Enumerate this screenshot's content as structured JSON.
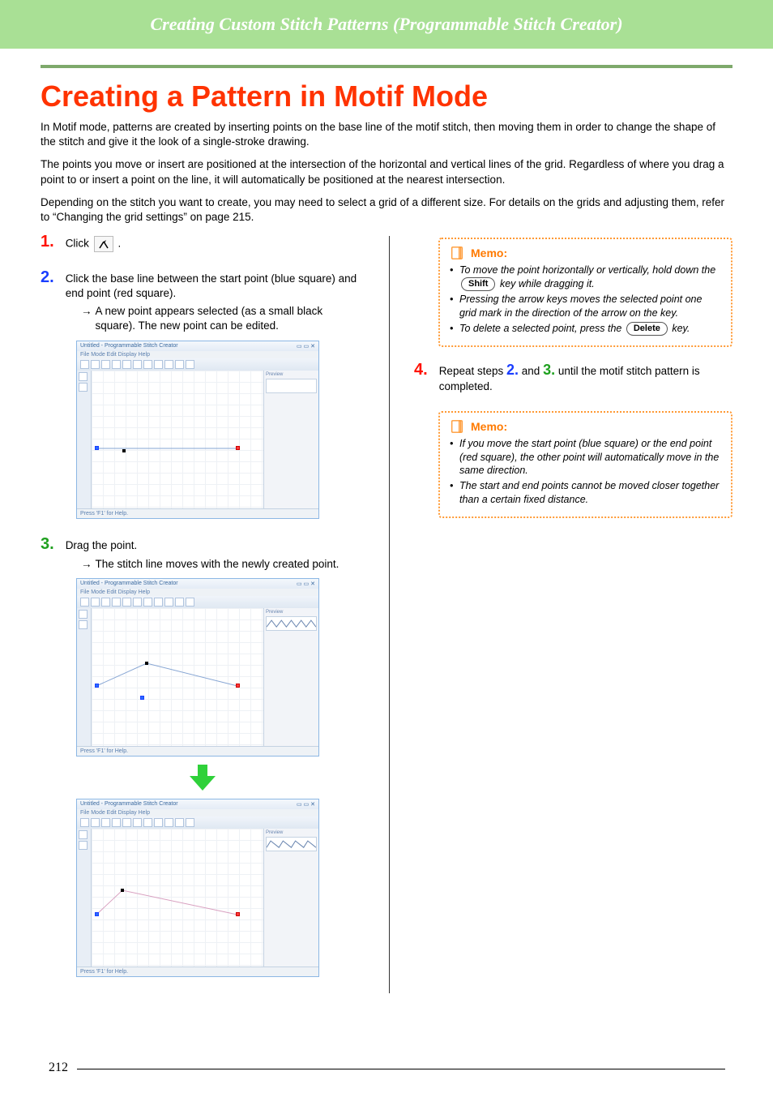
{
  "header": {
    "chapter_title": "Creating Custom Stitch Patterns (Programmable Stitch Creator)"
  },
  "title": "Creating a Pattern in Motif Mode",
  "intro": {
    "p1": "In Motif mode, patterns are created by inserting points on the base line of the motif stitch, then moving them in order to change the shape of the stitch and give it the look of a single-stroke drawing.",
    "p2": "The points you move or insert are positioned at the intersection of the horizontal and vertical lines of the grid. Regardless of where you drag a point to or insert a point on the line, it will automatically be positioned at the nearest intersection.",
    "p3": "Depending on the stitch you want to create, you may need to select a grid of a different size. For details on the grids and adjusting them, refer to “Changing the grid settings” on page 215."
  },
  "steps": {
    "s1": {
      "num": "1.",
      "text_before": "Click ",
      "text_after": "."
    },
    "s2": {
      "num": "2.",
      "text": "Click the base line between the start point (blue square) and end point (red square).",
      "sub": "A new point appears selected (as a small black square). The new point can be edited."
    },
    "s3": {
      "num": "3.",
      "text": "Drag the point.",
      "sub": "The stitch line moves with the newly created point."
    },
    "s4": {
      "num": "4.",
      "text_a": "Repeat steps ",
      "ref2": "2.",
      "text_b": " and ",
      "ref3": "3.",
      "text_c": " until the motif stitch pattern is completed."
    }
  },
  "memo1": {
    "title": "Memo:",
    "b1_a": "To move the point horizontally or vertically, hold down the ",
    "b1_key": "Shift",
    "b1_b": " key while dragging it.",
    "b2": "Pressing the arrow keys moves the selected point one grid mark in the direction of the arrow on the key.",
    "b3_a": "To delete a selected point, press the ",
    "b3_key": "Delete",
    "b3_b": " key."
  },
  "memo2": {
    "title": "Memo:",
    "b1": "If you move the start point (blue square) or the end point (red square), the other point will automatically move in the same direction.",
    "b2": "The start and end points cannot be moved closer together than a certain fixed distance."
  },
  "window": {
    "title": "Untitled - Programmable Stitch Creator",
    "menu": "File   Mode   Edit   Display   Help",
    "preview": "Preview",
    "status": "Press 'F1' for Help."
  },
  "page_number": "212"
}
